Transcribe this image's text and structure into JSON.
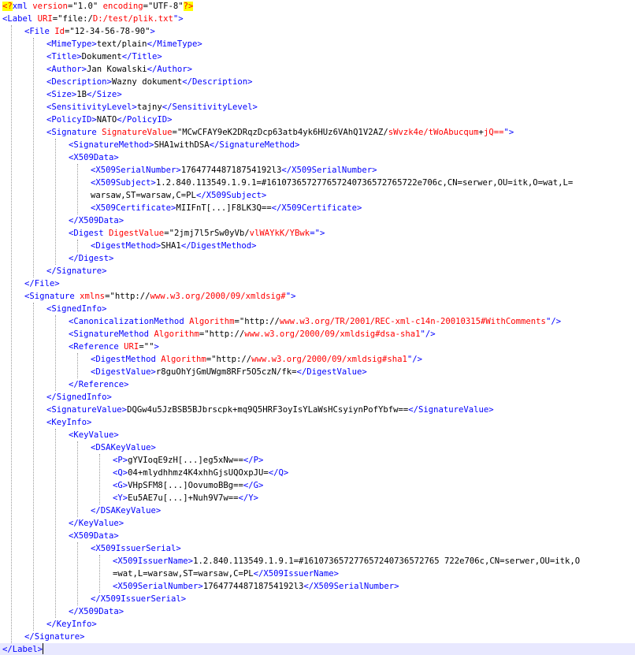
{
  "editor": {
    "colors": {
      "tag": "#0000ff",
      "attr": "#ff0000",
      "text": "#000000",
      "value_red": "#ff0000",
      "value_purple": "#8000ff",
      "current_line": "#e8e8ff",
      "decl_highlight": "#ffff00",
      "guide": "#9a9a9a"
    },
    "lines": [
      {
        "indent": 0,
        "tokens": [
          {
            "t": "<?",
            "c": "decl"
          },
          {
            "t": "xml",
            "c": "tag"
          },
          {
            "t": " version",
            "c": "attr"
          },
          {
            "t": "=\"1.0\"",
            "c": "text"
          },
          {
            "t": " encoding",
            "c": "attr"
          },
          {
            "t": "=\"UTF-8\"",
            "c": "text"
          },
          {
            "t": "?>",
            "c": "decl"
          }
        ]
      },
      {
        "indent": 0,
        "tokens": [
          {
            "t": "<Label ",
            "c": "tag"
          },
          {
            "t": "URI",
            "c": "attr"
          },
          {
            "t": "=\"file:/",
            "c": "text"
          },
          {
            "t": "D:/test/plik.txt",
            "c": "value_red"
          },
          {
            "t": "\">",
            "c": "tag"
          }
        ]
      },
      {
        "indent": 1,
        "tokens": [
          {
            "t": "<File ",
            "c": "tag"
          },
          {
            "t": "Id",
            "c": "attr"
          },
          {
            "t": "=\"12-34-56-78-90\"",
            "c": "text"
          },
          {
            "t": ">",
            "c": "tag"
          }
        ]
      },
      {
        "indent": 2,
        "tokens": [
          {
            "t": "<MimeType>",
            "c": "tag"
          },
          {
            "t": "text/plain",
            "c": "text"
          },
          {
            "t": "</MimeType>",
            "c": "tag"
          }
        ]
      },
      {
        "indent": 2,
        "tokens": [
          {
            "t": "<Title>",
            "c": "tag"
          },
          {
            "t": "Dokument",
            "c": "text"
          },
          {
            "t": "</Title>",
            "c": "tag"
          }
        ]
      },
      {
        "indent": 2,
        "tokens": [
          {
            "t": "<Author>",
            "c": "tag"
          },
          {
            "t": "Jan Kowalski",
            "c": "text"
          },
          {
            "t": "</Author>",
            "c": "tag"
          }
        ]
      },
      {
        "indent": 2,
        "tokens": [
          {
            "t": "<Description>",
            "c": "tag"
          },
          {
            "t": "Wazny dokument",
            "c": "text"
          },
          {
            "t": "</Description>",
            "c": "tag"
          }
        ]
      },
      {
        "indent": 2,
        "tokens": [
          {
            "t": "<Size>",
            "c": "tag"
          },
          {
            "t": "1B",
            "c": "text"
          },
          {
            "t": "</Size>",
            "c": "tag"
          }
        ]
      },
      {
        "indent": 2,
        "tokens": [
          {
            "t": "<SensitivityLevel>",
            "c": "tag"
          },
          {
            "t": "tajny",
            "c": "text"
          },
          {
            "t": "</SensitivityLevel>",
            "c": "tag"
          }
        ]
      },
      {
        "indent": 2,
        "tokens": [
          {
            "t": "<PolicyID>",
            "c": "tag"
          },
          {
            "t": "NATO",
            "c": "text"
          },
          {
            "t": "</PolicyID>",
            "c": "tag"
          }
        ]
      },
      {
        "indent": 2,
        "tokens": [
          {
            "t": "<Signature ",
            "c": "tag"
          },
          {
            "t": "SignatureValue",
            "c": "attr"
          },
          {
            "t": "=\"MCwCFAY9eK2DRqzDcp63atb4yk6HUz6VAhQ1V2AZ/",
            "c": "text"
          },
          {
            "t": "sWvzk4e/tWoAbucqum",
            "c": "value_red"
          },
          {
            "t": "+",
            "c": "text"
          },
          {
            "t": "jQ==",
            "c": "value_red"
          },
          {
            "t": "\">",
            "c": "tag"
          }
        ]
      },
      {
        "indent": 3,
        "tokens": [
          {
            "t": "<SignatureMethod>",
            "c": "tag"
          },
          {
            "t": "SHA1withDSA",
            "c": "text"
          },
          {
            "t": "</SignatureMethod>",
            "c": "tag"
          }
        ]
      },
      {
        "indent": 3,
        "tokens": [
          {
            "t": "<X509Data>",
            "c": "tag"
          }
        ]
      },
      {
        "indent": 4,
        "tokens": [
          {
            "t": "<X509SerialNumber>",
            "c": "tag"
          },
          {
            "t": "176477448718754192l3",
            "c": "text"
          },
          {
            "t": "</X509SerialNumber>",
            "c": "tag"
          }
        ]
      },
      {
        "indent": 4,
        "tokens": [
          {
            "t": "<X509Subject>",
            "c": "tag"
          },
          {
            "t": "1.2.840.113549.1.9.1=#161073657277657240736572765722e706c,CN=serwer,OU=itk,O=wat,L=",
            "c": "text"
          }
        ]
      },
      {
        "indent": 4,
        "tokens": [
          {
            "t": "warsaw,ST=warsaw,C=PL",
            "c": "text"
          },
          {
            "t": "</X509Subject>",
            "c": "tag"
          }
        ]
      },
      {
        "indent": 4,
        "tokens": [
          {
            "t": "<X509Certificate>",
            "c": "tag"
          },
          {
            "t": "MIIFnT[...]F8LK3Q==",
            "c": "text"
          },
          {
            "t": "</X509Certificate>",
            "c": "tag"
          }
        ]
      },
      {
        "indent": 3,
        "tokens": [
          {
            "t": "</X509Data>",
            "c": "tag"
          }
        ]
      },
      {
        "indent": 3,
        "tokens": [
          {
            "t": "<Digest ",
            "c": "tag"
          },
          {
            "t": "DigestValue",
            "c": "attr"
          },
          {
            "t": "=\"2jmj7l5rSw0yVb/",
            "c": "text"
          },
          {
            "t": "vlWAYkK/YBwk",
            "c": "value_red"
          },
          {
            "t": "=\">",
            "c": "tag"
          }
        ]
      },
      {
        "indent": 4,
        "tokens": [
          {
            "t": "<DigestMethod>",
            "c": "tag"
          },
          {
            "t": "SHA1",
            "c": "text"
          },
          {
            "t": "</DigestMethod>",
            "c": "tag"
          }
        ]
      },
      {
        "indent": 3,
        "tokens": [
          {
            "t": "</Digest>",
            "c": "tag"
          }
        ]
      },
      {
        "indent": 2,
        "tokens": [
          {
            "t": "</Signature>",
            "c": "tag"
          }
        ]
      },
      {
        "indent": 1,
        "tokens": [
          {
            "t": "</File>",
            "c": "tag"
          }
        ]
      },
      {
        "indent": 1,
        "tokens": [
          {
            "t": "<Signature ",
            "c": "tag"
          },
          {
            "t": "xmlns",
            "c": "attr"
          },
          {
            "t": "=\"http://",
            "c": "text"
          },
          {
            "t": "www.w3.org/2000/09/xmldsig#",
            "c": "value_red"
          },
          {
            "t": "\">",
            "c": "tag"
          }
        ]
      },
      {
        "indent": 2,
        "tokens": [
          {
            "t": "<SignedInfo>",
            "c": "tag"
          }
        ]
      },
      {
        "indent": 3,
        "tokens": [
          {
            "t": "<CanonicalizationMethod ",
            "c": "tag"
          },
          {
            "t": "Algorithm",
            "c": "attr"
          },
          {
            "t": "=\"http://",
            "c": "text"
          },
          {
            "t": "www.w3.org/TR/2001/REC-xml-c14n-20010315#WithComments",
            "c": "value_red"
          },
          {
            "t": "\"/>",
            "c": "tag"
          }
        ]
      },
      {
        "indent": 3,
        "tokens": [
          {
            "t": "<SignatureMethod ",
            "c": "tag"
          },
          {
            "t": "Algorithm",
            "c": "attr"
          },
          {
            "t": "=\"http://",
            "c": "text"
          },
          {
            "t": "www.w3.org/2000/09/xmldsig#dsa-sha1",
            "c": "value_red"
          },
          {
            "t": "\"/>",
            "c": "tag"
          }
        ]
      },
      {
        "indent": 3,
        "tokens": [
          {
            "t": "<Reference ",
            "c": "tag"
          },
          {
            "t": "URI",
            "c": "attr"
          },
          {
            "t": "=\"\"",
            "c": "text"
          },
          {
            "t": ">",
            "c": "tag"
          }
        ]
      },
      {
        "indent": 4,
        "tokens": [
          {
            "t": "<DigestMethod ",
            "c": "tag"
          },
          {
            "t": "Algorithm",
            "c": "attr"
          },
          {
            "t": "=\"http://",
            "c": "text"
          },
          {
            "t": "www.w3.org/2000/09/xmldsig#sha1",
            "c": "value_red"
          },
          {
            "t": "\"/>",
            "c": "tag"
          }
        ]
      },
      {
        "indent": 4,
        "tokens": [
          {
            "t": "<DigestValue>",
            "c": "tag"
          },
          {
            "t": "r8guOhYjGmUWgm8RFr5O5czN/fk=",
            "c": "text"
          },
          {
            "t": "</DigestValue>",
            "c": "tag"
          }
        ]
      },
      {
        "indent": 3,
        "tokens": [
          {
            "t": "</Reference>",
            "c": "tag"
          }
        ]
      },
      {
        "indent": 2,
        "tokens": [
          {
            "t": "</SignedInfo>",
            "c": "tag"
          }
        ]
      },
      {
        "indent": 2,
        "tokens": [
          {
            "t": "<SignatureValue>",
            "c": "tag"
          },
          {
            "t": "DQGw4u5JzBSB5BJbrscpk+mq9Q5HRF3oyIsYLaWsHCsyiynPofYbfw==",
            "c": "text"
          },
          {
            "t": "</SignatureValue>",
            "c": "tag"
          }
        ]
      },
      {
        "indent": 2,
        "tokens": [
          {
            "t": "<KeyInfo>",
            "c": "tag"
          }
        ]
      },
      {
        "indent": 3,
        "tokens": [
          {
            "t": "<KeyValue>",
            "c": "tag"
          }
        ]
      },
      {
        "indent": 4,
        "tokens": [
          {
            "t": "<DSAKeyValue>",
            "c": "tag"
          }
        ]
      },
      {
        "indent": 5,
        "tokens": [
          {
            "t": "<P>",
            "c": "tag"
          },
          {
            "t": "gYVIoqE9zH[...]eg5xNw==",
            "c": "text"
          },
          {
            "t": "</P>",
            "c": "tag"
          }
        ]
      },
      {
        "indent": 5,
        "tokens": [
          {
            "t": "<Q>",
            "c": "tag"
          },
          {
            "t": "04+mlydhhmz4K4xhhGjsUQOxpJU=",
            "c": "text"
          },
          {
            "t": "</Q>",
            "c": "tag"
          }
        ]
      },
      {
        "indent": 5,
        "tokens": [
          {
            "t": "<G>",
            "c": "tag"
          },
          {
            "t": "VHpSFM8[...]OovumoBBg==",
            "c": "text"
          },
          {
            "t": "</G>",
            "c": "tag"
          }
        ]
      },
      {
        "indent": 5,
        "tokens": [
          {
            "t": "<Y>",
            "c": "tag"
          },
          {
            "t": "Eu5AE7u[...]+Nuh9V7w==",
            "c": "text"
          },
          {
            "t": "</Y>",
            "c": "tag"
          }
        ]
      },
      {
        "indent": 4,
        "tokens": [
          {
            "t": "</DSAKeyValue>",
            "c": "tag"
          }
        ]
      },
      {
        "indent": 3,
        "tokens": [
          {
            "t": "</KeyValue>",
            "c": "tag"
          }
        ]
      },
      {
        "indent": 3,
        "tokens": [
          {
            "t": "<X509Data>",
            "c": "tag"
          }
        ]
      },
      {
        "indent": 4,
        "tokens": [
          {
            "t": "<X509IssuerSerial>",
            "c": "tag"
          }
        ]
      },
      {
        "indent": 5,
        "tokens": [
          {
            "t": "<X509IssuerName>",
            "c": "tag"
          },
          {
            "t": "1.2.840.113549.1.9.1=#161073657277657240736572765 722e706c,CN=serwer,OU=itk,O",
            "c": "text"
          }
        ]
      },
      {
        "indent": 5,
        "tokens": [
          {
            "t": "=wat,L=warsaw,ST=warsaw,C=PL",
            "c": "text"
          },
          {
            "t": "</X509IssuerName>",
            "c": "tag"
          }
        ]
      },
      {
        "indent": 5,
        "tokens": [
          {
            "t": "<X509SerialNumber>",
            "c": "tag"
          },
          {
            "t": "176477448718754192l3",
            "c": "text"
          },
          {
            "t": "</X509SerialNumber>",
            "c": "tag"
          }
        ]
      },
      {
        "indent": 4,
        "tokens": [
          {
            "t": "</X509IssuerSerial>",
            "c": "tag"
          }
        ]
      },
      {
        "indent": 3,
        "tokens": [
          {
            "t": "</X509Data>",
            "c": "tag"
          }
        ]
      },
      {
        "indent": 2,
        "tokens": [
          {
            "t": "</KeyInfo>",
            "c": "tag"
          }
        ]
      },
      {
        "indent": 1,
        "tokens": [
          {
            "t": "</Signature>",
            "c": "tag"
          }
        ]
      },
      {
        "indent": 0,
        "current": true,
        "tokens": [
          {
            "t": "</Label>",
            "c": "tag"
          }
        ]
      }
    ]
  }
}
